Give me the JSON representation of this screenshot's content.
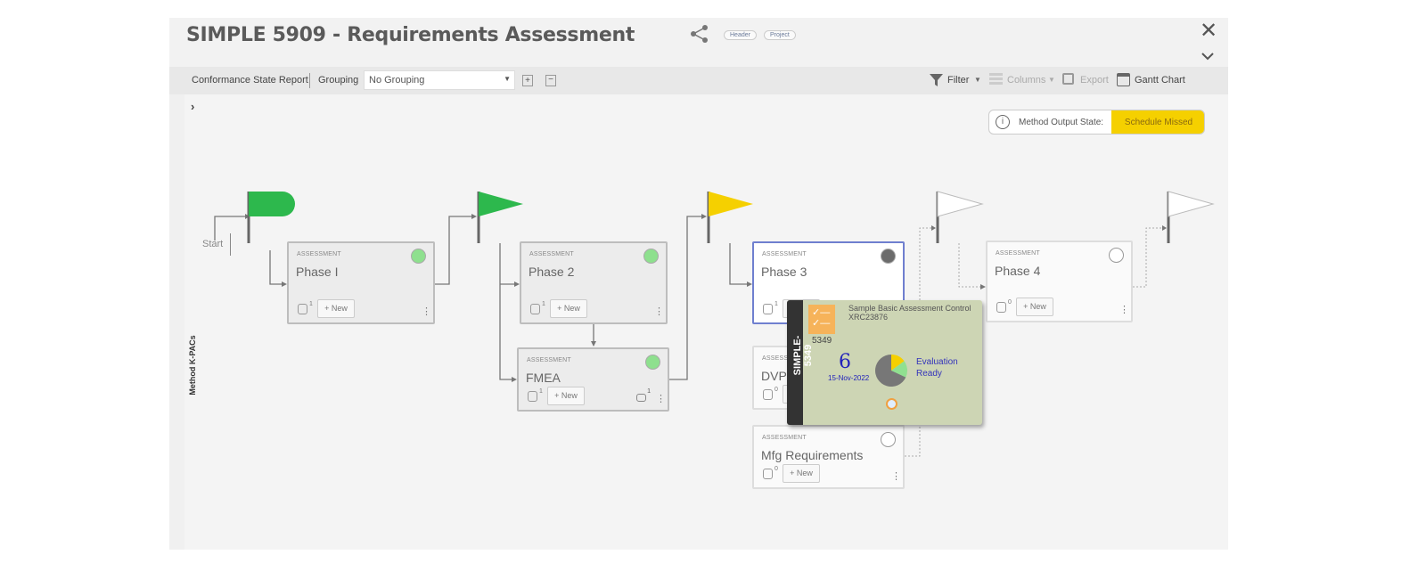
{
  "header": {
    "title": "SIMPLE 5909 - Requirements Assessment",
    "tags": [
      "Header",
      "Project"
    ],
    "share_icon": "share-icon",
    "close_icon": "close-icon",
    "collapse_icon": "chevron-down-icon"
  },
  "toolbar": {
    "report": "Conformance State Report",
    "grouping_label": "Grouping",
    "grouping_value": "No Grouping",
    "filter": "Filter",
    "columns": "Columns",
    "export": "Export",
    "gantt": "Gantt Chart"
  },
  "canvas": {
    "side_label": "Method K-PACs",
    "expand": "›",
    "start": "Start",
    "output_state": {
      "label": "Method Output State:",
      "value": "Schedule Missed",
      "color": "#f5d000"
    },
    "flags": [
      {
        "color": "#2db84d"
      },
      {
        "color": "#2db84d"
      },
      {
        "color": "#f5d000"
      },
      {
        "color": "#ffffff"
      },
      {
        "color": "#ffffff"
      }
    ],
    "cards": [
      {
        "type": "ASSESSMENT",
        "name": "Phase I",
        "count": "1",
        "new": "+ New",
        "status": "#8ee08e"
      },
      {
        "type": "ASSESSMENT",
        "name": "Phase 2",
        "count": "1",
        "new": "+ New",
        "status": "#8ee08e"
      },
      {
        "type": "ASSESSMENT",
        "name": "FMEA",
        "count": "1",
        "new": "+ New",
        "status": "#8ee08e",
        "comments": "1"
      },
      {
        "type": "ASSESSMENT",
        "name": "Phase 3",
        "count": "1",
        "new": "+ New",
        "status": "#6b6b6b"
      },
      {
        "type": "ASSESSMENT",
        "name": "DVP&R",
        "count": "0",
        "new": "+ New",
        "status": "#ffffff"
      },
      {
        "type": "ASSESSMENT",
        "name": "Mfg Requirements",
        "count": "0",
        "new": "+ New",
        "status": "#ffffff"
      },
      {
        "type": "ASSESSMENT",
        "name": "Phase 4",
        "count": "0",
        "new": "+ New",
        "status": "#ffffff"
      }
    ]
  },
  "popup": {
    "id": "SIMPLE-5349",
    "title": "Sample Basic Assessment Control",
    "code": "XRC23876",
    "number": "5349",
    "big": "6",
    "date": "15-Nov-2022",
    "state": "Evaluation Ready",
    "pie": [
      {
        "color": "#f5d000",
        "value": 15
      },
      {
        "color": "#90e090",
        "value": 17
      },
      {
        "color": "#777777",
        "value": 68
      }
    ]
  }
}
